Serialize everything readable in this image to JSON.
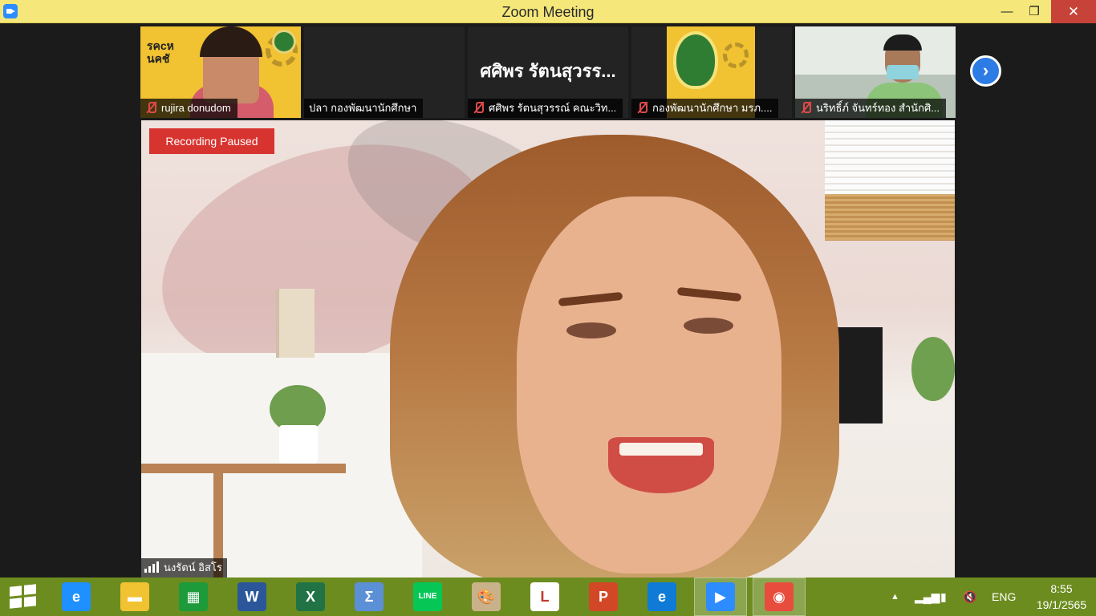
{
  "window": {
    "title": "Zoom Meeting",
    "controls": {
      "minimize": "—",
      "maximize": "❐",
      "close": "✕"
    }
  },
  "thumbnails": [
    {
      "name": "rujira donudom",
      "muted": true,
      "card_text": "รคcห\nนคชั"
    },
    {
      "name": "ปลา กองพัฒนานักศึกษา",
      "muted": false
    },
    {
      "name": "ศศิพร รัตนสุวรรณ์ คณะวิท...",
      "muted": true,
      "big_label": "ศศิพร รัตนสุวรร..."
    },
    {
      "name": "กองพัฒนานักศึกษา มรภ....",
      "muted": true
    },
    {
      "name": "นริทธิ์ภ์ จันทร์ทอง สำนักศิ...",
      "muted": true
    }
  ],
  "next_page_icon": "chevron-right-icon",
  "speaker": {
    "recording_status": "Recording Paused",
    "name": "นงรัตน์ อิสโร"
  },
  "taskbar": {
    "apps": [
      {
        "name": "internet-explorer-icon",
        "glyph": "e",
        "color": "#1e90ff"
      },
      {
        "name": "file-explorer-icon",
        "glyph": "▬",
        "color": "#f1c232"
      },
      {
        "name": "store-icon",
        "glyph": "▦",
        "color": "#1d9a3a"
      },
      {
        "name": "word-icon",
        "glyph": "W",
        "color": "#2b579a"
      },
      {
        "name": "excel-icon",
        "glyph": "X",
        "color": "#217346"
      },
      {
        "name": "math-icon",
        "glyph": "Σ",
        "color": "#5b8fd6"
      },
      {
        "name": "line-icon",
        "glyph": "LINE",
        "color": "#06c755"
      },
      {
        "name": "paint-icon",
        "glyph": "🎨",
        "color": "#c9b18a"
      },
      {
        "name": "lisrel-icon",
        "glyph": "L",
        "color": "#ffffff"
      },
      {
        "name": "powerpoint-icon",
        "glyph": "P",
        "color": "#d24726"
      },
      {
        "name": "edge-icon",
        "glyph": "e",
        "color": "#0f7bd6"
      },
      {
        "name": "zoom-icon",
        "glyph": "▶",
        "color": "#2d8cff"
      },
      {
        "name": "chrome-icon",
        "glyph": "◉",
        "color": "#e74c3c"
      }
    ],
    "active_apps": [
      "zoom-icon",
      "chrome-icon"
    ],
    "tray": {
      "language": "ENG",
      "time": "8:55",
      "date": "19/1/2565"
    }
  }
}
